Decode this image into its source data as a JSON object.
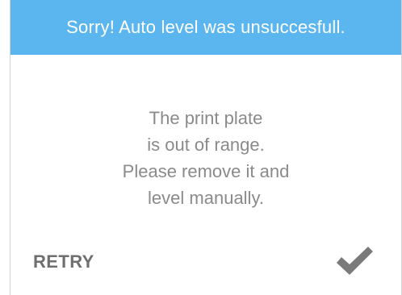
{
  "header": {
    "title": "Sorry! Auto level was unsuccesfull.",
    "background_color": "#5bb6f0"
  },
  "message": {
    "lines": [
      "The print plate",
      "is out of range.",
      "Please remove it and",
      "level manually."
    ]
  },
  "actions": {
    "retry_label": "RETRY",
    "confirm_icon": "checkmark-icon"
  }
}
